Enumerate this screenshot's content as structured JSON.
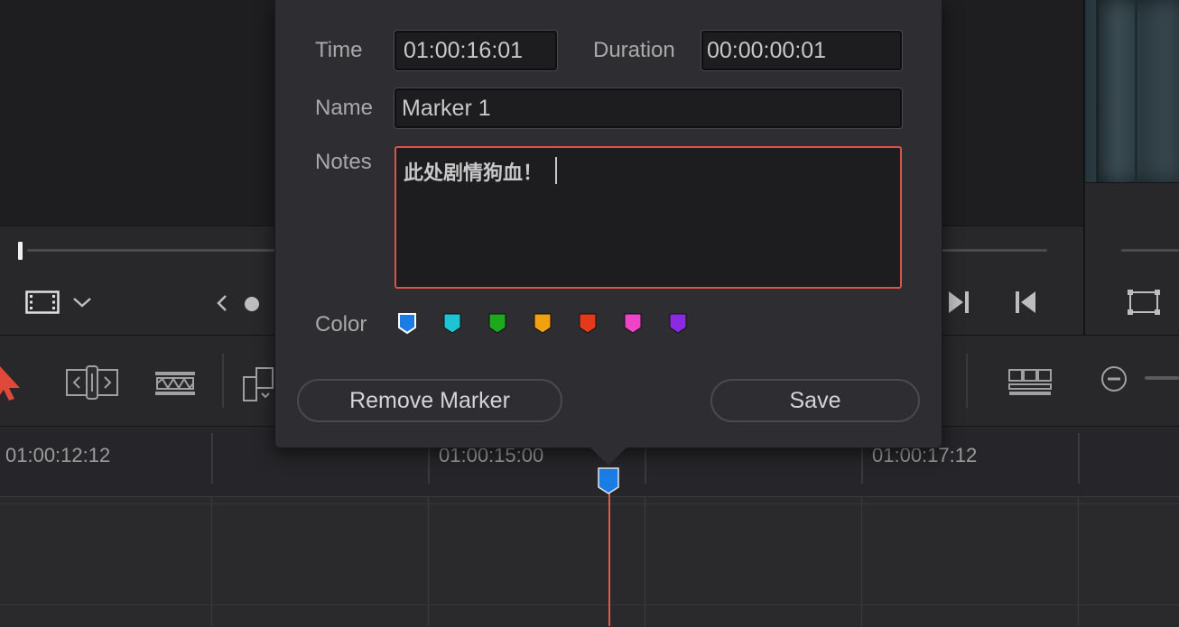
{
  "dialog": {
    "time_label": "Time",
    "time_value": "01:00:16:01",
    "duration_label": "Duration",
    "duration_value": "00:00:00:01",
    "name_label": "Name",
    "name_value": "Marker 1",
    "notes_label": "Notes",
    "notes_value": "此处剧情狗血！",
    "color_label": "Color",
    "colors": [
      {
        "name": "blue",
        "hex": "#1a7de6",
        "selected": true
      },
      {
        "name": "cyan",
        "hex": "#1ec4d4",
        "selected": false
      },
      {
        "name": "green",
        "hex": "#1ea81e",
        "selected": false
      },
      {
        "name": "yellow",
        "hex": "#f0a010",
        "selected": false
      },
      {
        "name": "red",
        "hex": "#e43a1a",
        "selected": false
      },
      {
        "name": "pink",
        "hex": "#ee44c8",
        "selected": false
      },
      {
        "name": "purple",
        "hex": "#8a2be2",
        "selected": false
      }
    ],
    "remove_label": "Remove Marker",
    "save_label": "Save"
  },
  "timeline": {
    "timecodes": [
      "01:00:12:12",
      "01:00:15:00",
      "01:00:17:12"
    ],
    "marker_color": "#1a7de6",
    "playhead_color": "#e05a4c"
  },
  "icons": [
    "film-icon",
    "chevron-down-icon",
    "chevron-left-icon",
    "dot-icon",
    "skip-forward-icon",
    "skip-back-icon",
    "viewer-frame-icon",
    "pointer-arrow-icon",
    "trim-tool-icon",
    "blade-tool-icon",
    "clip-stack-icon",
    "track-view-icon",
    "zoom-out-icon"
  ]
}
